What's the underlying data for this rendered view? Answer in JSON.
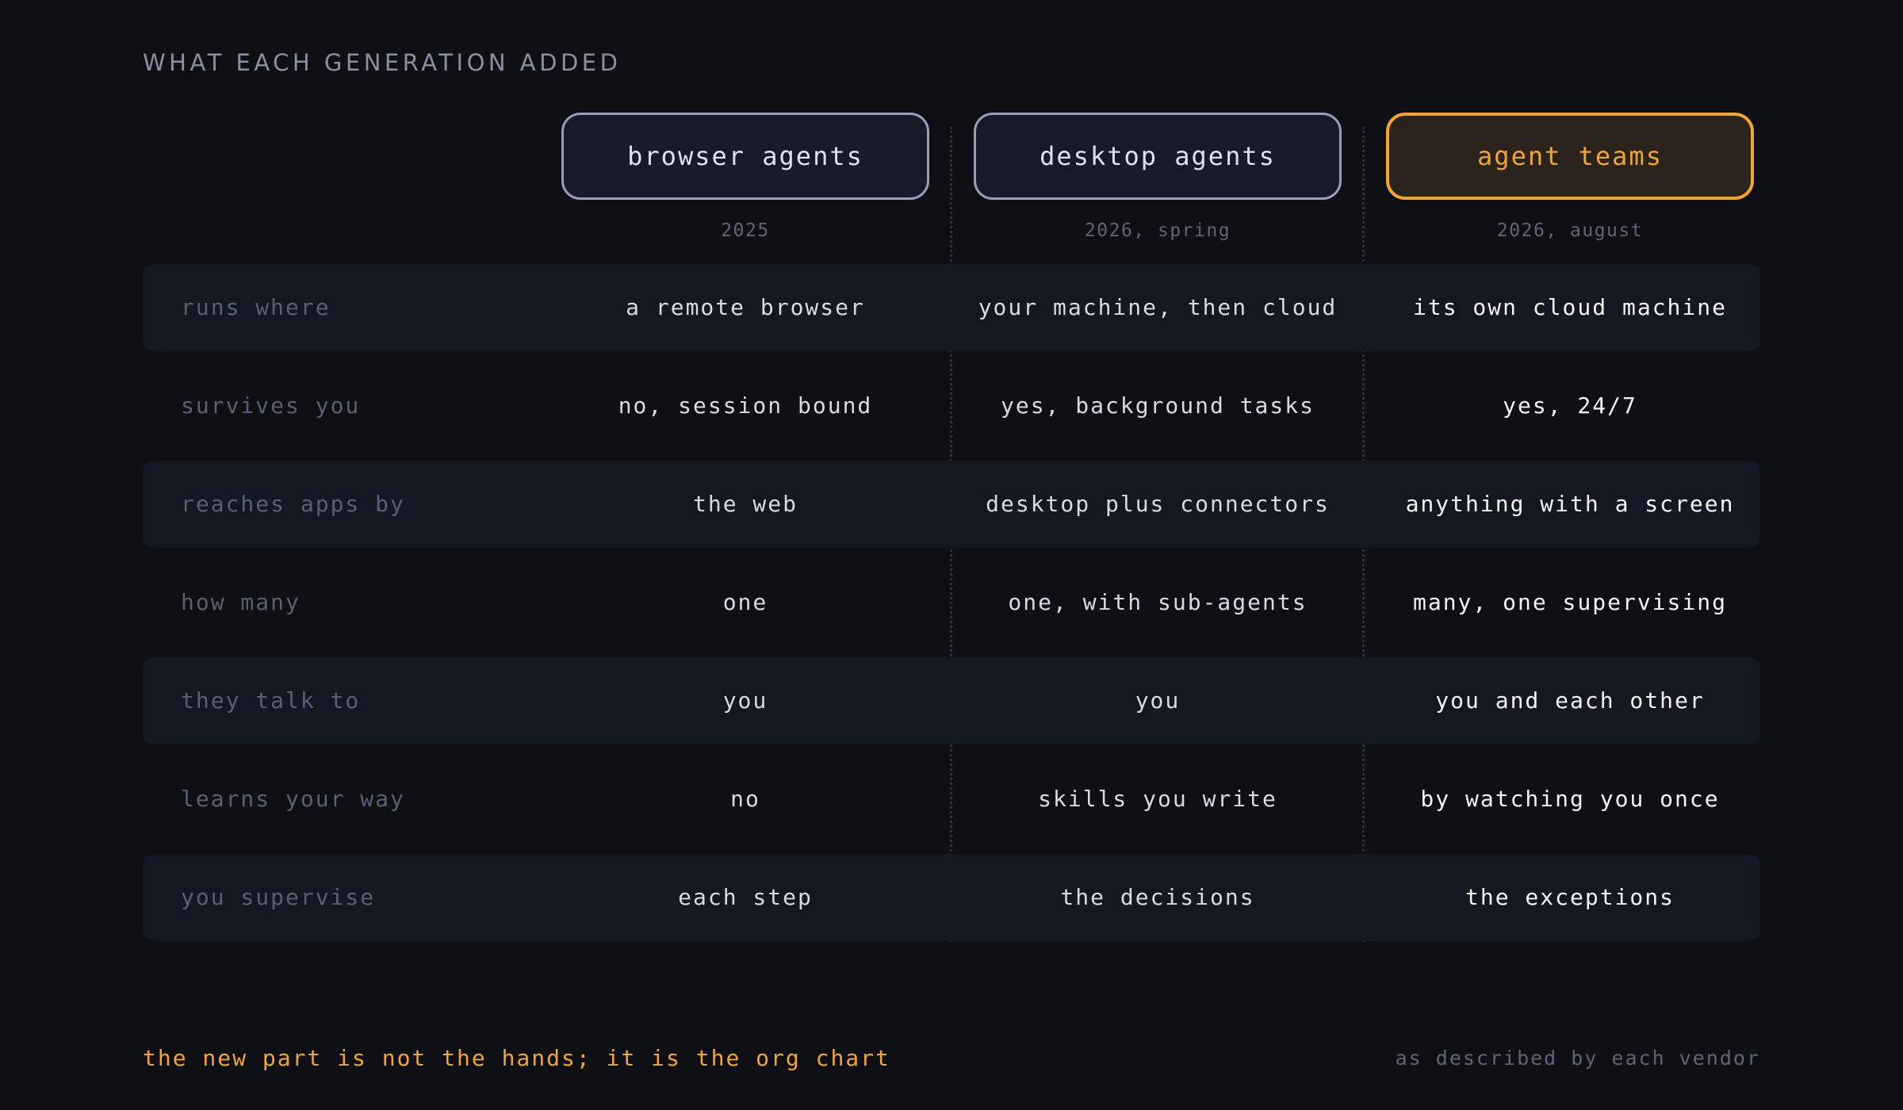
{
  "kicker": "WHAT EACH GENERATION ADDED",
  "columns": [
    {
      "title": "browser agents",
      "year": "2025",
      "highlight": false
    },
    {
      "title": "desktop agents",
      "year": "2026, spring",
      "highlight": false
    },
    {
      "title": "agent teams",
      "year": "2026, august",
      "highlight": true
    }
  ],
  "rows": [
    {
      "label": "runs where",
      "values": [
        "a remote browser",
        "your machine, then cloud",
        "its own cloud machine"
      ]
    },
    {
      "label": "survives you",
      "values": [
        "no, session bound",
        "yes, background tasks",
        "yes, 24/7"
      ]
    },
    {
      "label": "reaches apps by",
      "values": [
        "the web",
        "desktop plus connectors",
        "anything with a screen"
      ]
    },
    {
      "label": "how many",
      "values": [
        "one",
        "one, with sub-agents",
        "many, one supervising"
      ]
    },
    {
      "label": "they talk to",
      "values": [
        "you",
        "you",
        "you and each other"
      ]
    },
    {
      "label": "learns your way",
      "values": [
        "no",
        "skills you write",
        "by watching you once"
      ]
    },
    {
      "label": "you supervise",
      "values": [
        "each step",
        "the decisions",
        "the exceptions"
      ]
    }
  ],
  "footer": {
    "tagline": "the new part is not the hands; it is the org chart",
    "source": "as described by each vendor"
  },
  "colors": {
    "background": "#0f1016",
    "accent": "#f2a530",
    "row_shade": "#141823",
    "label": "#596070"
  }
}
